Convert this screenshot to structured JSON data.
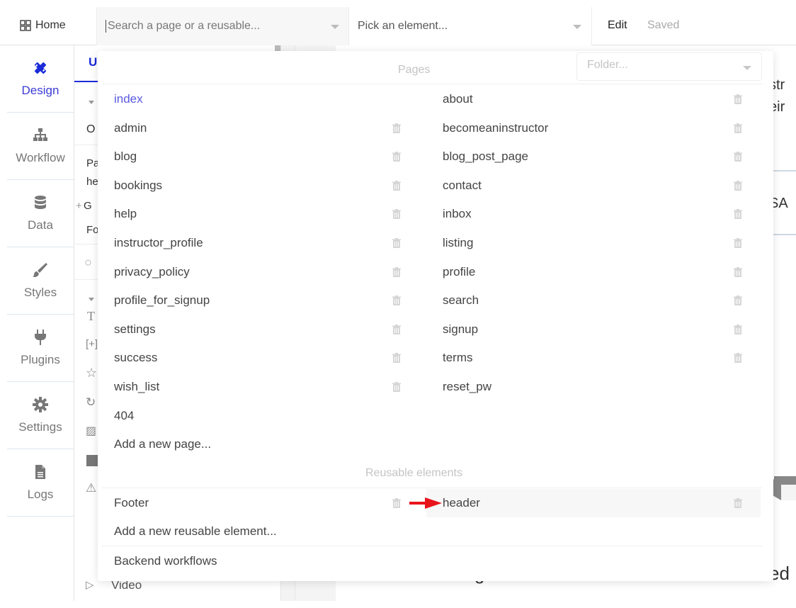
{
  "topbar": {
    "home_label": "Home",
    "search_placeholder": "Search a page or a reusable...",
    "element_picker_placeholder": "Pick an element...",
    "edit_label": "Edit",
    "save_status": "Saved"
  },
  "leftnav": {
    "items": [
      {
        "label": "Design",
        "icon": "design-icon",
        "active": true
      },
      {
        "label": "Workflow",
        "icon": "workflow-icon",
        "active": false
      },
      {
        "label": "Data",
        "icon": "database-icon",
        "active": false
      },
      {
        "label": "Styles",
        "icon": "brush-icon",
        "active": false
      },
      {
        "label": "Plugins",
        "icon": "plug-icon",
        "active": false
      },
      {
        "label": "Settings",
        "icon": "gear-icon",
        "active": false
      },
      {
        "label": "Logs",
        "icon": "document-icon",
        "active": false
      }
    ]
  },
  "panel2": {
    "tab_label": "U",
    "fragments": [
      "O",
      "Pa",
      "he",
      "G",
      "Fo"
    ],
    "video_label": "Video"
  },
  "canvas": {
    "fragments": [
      "str",
      "eir",
      "SA",
      "ed",
      "g"
    ]
  },
  "dropdown": {
    "pages_title": "Pages",
    "folder_placeholder": "Folder...",
    "pages_left": [
      {
        "name": "index",
        "current": true,
        "deletable": false
      },
      {
        "name": "admin",
        "deletable": true
      },
      {
        "name": "blog",
        "deletable": true
      },
      {
        "name": "bookings",
        "deletable": true
      },
      {
        "name": "help",
        "deletable": true
      },
      {
        "name": "instructor_profile",
        "deletable": true
      },
      {
        "name": "privacy_policy",
        "deletable": true
      },
      {
        "name": "profile_for_signup",
        "deletable": true
      },
      {
        "name": "settings",
        "deletable": true
      },
      {
        "name": "success",
        "deletable": true
      },
      {
        "name": "wish_list",
        "deletable": true
      },
      {
        "name": "404",
        "deletable": false
      },
      {
        "name": "Add a new page...",
        "deletable": false
      }
    ],
    "pages_right": [
      {
        "name": "about",
        "deletable": true
      },
      {
        "name": "becomeaninstructor",
        "deletable": true
      },
      {
        "name": "blog_post_page",
        "deletable": true
      },
      {
        "name": "contact",
        "deletable": true
      },
      {
        "name": "inbox",
        "deletable": true
      },
      {
        "name": "listing",
        "deletable": true
      },
      {
        "name": "profile",
        "deletable": true
      },
      {
        "name": "search",
        "deletable": true
      },
      {
        "name": "signup",
        "deletable": true
      },
      {
        "name": "terms",
        "deletable": true
      },
      {
        "name": "reset_pw",
        "deletable": false
      }
    ],
    "reusable_title": "Reusable elements",
    "reusable_left": [
      {
        "name": "Footer",
        "deletable": true
      },
      {
        "name": "Add a new reusable element...",
        "deletable": false
      }
    ],
    "reusable_right": [
      {
        "name": "header",
        "deletable": true,
        "highlighted": true
      }
    ],
    "backend_label": "Backend workflows"
  },
  "annotations": {
    "arrow_color": "#e8141b"
  },
  "colors": {
    "accent": "#3b3bd8",
    "current_page": "#5a5ae0",
    "muted": "#c4c4c4"
  }
}
